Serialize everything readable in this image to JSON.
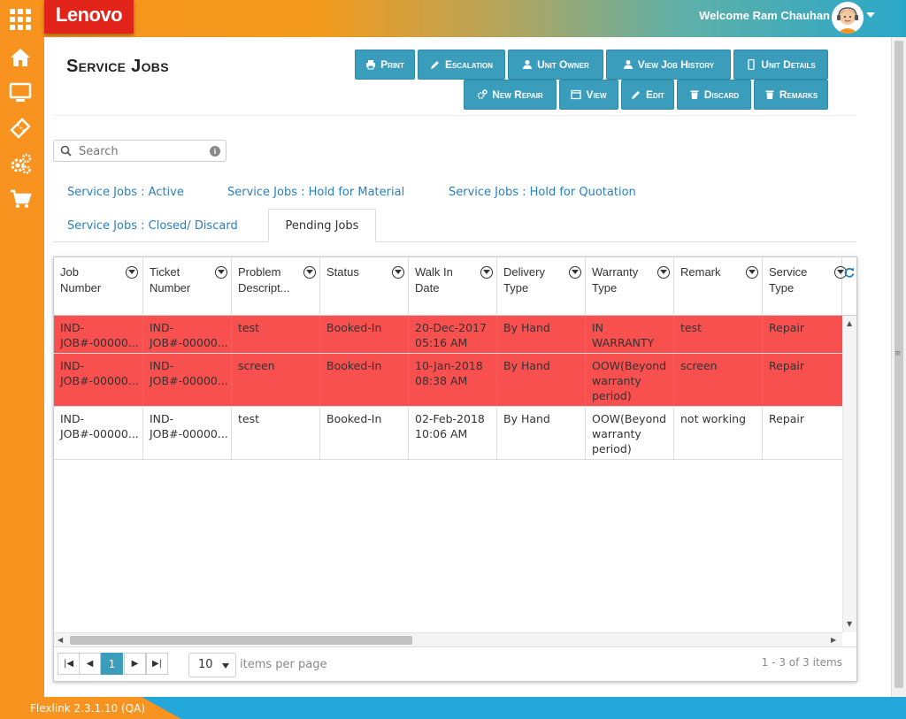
{
  "header": {
    "logo": "Lenovo",
    "welcome": "Welcome Ram Chauhan"
  },
  "sidebar": {
    "items": [
      "home-icon",
      "monitor-icon",
      "ticket-icon",
      "gears-icon",
      "cart-icon"
    ]
  },
  "page": {
    "title": "Service Jobs"
  },
  "toolbar": {
    "print": "Print",
    "escalation": "Escalation",
    "unit_owner": "Unit Owner",
    "view_job_history": "View Job History",
    "unit_details": "Unit Details",
    "new_repair": "New Repair",
    "view": "View",
    "edit": "Edit",
    "discard": "Discard",
    "remarks": "Remarks"
  },
  "search": {
    "placeholder": "Search"
  },
  "tabs": [
    "Service Jobs : Active",
    "Service Jobs : Hold for Material",
    "Service Jobs : Hold for Quotation",
    "Service Jobs : Closed/ Discard",
    "Pending Jobs"
  ],
  "grid": {
    "columns": [
      "Job Number",
      "Ticket Number",
      "Problem Descript...",
      "Status",
      "Walk In Date",
      "Delivery Type",
      "Warranty Type",
      "Remark",
      "Service Type"
    ],
    "rows": [
      {
        "highlight": "#f84f4f",
        "job": "IND-JOB#-00000...",
        "ticket": "IND-JOB#-00000...",
        "problem": "test",
        "status": "Booked-In",
        "walkin": "20-Dec-2017 05:16 AM",
        "delivery": "By Hand",
        "warranty": "IN WARRANTY",
        "remark": "test",
        "service": "Repair"
      },
      {
        "highlight": "#f84f4f",
        "job": "IND-JOB#-00000...",
        "ticket": "IND-JOB#-00000...",
        "problem": "screen",
        "status": "Booked-In",
        "walkin": "10-Jan-2018 08:38 AM",
        "delivery": "By Hand",
        "warranty": "OOW(Beyond warranty period)",
        "remark": "screen",
        "service": "Repair"
      },
      {
        "highlight": "#ffffff",
        "job": "IND-JOB#-00000...",
        "ticket": "IND-JOB#-00000...",
        "problem": "test",
        "status": "Booked-In",
        "walkin": "02-Feb-2018 10:06 AM",
        "delivery": "By Hand",
        "warranty": "OOW(Beyond warranty period)",
        "remark": "not working",
        "service": "Repair"
      }
    ]
  },
  "pager": {
    "current_page": "1",
    "page_size": "10",
    "items_per_page": "items per page",
    "summary": "1 - 3 of 3 items"
  },
  "footer": {
    "version": "Flexlink 2.3.1.10 (QA)"
  },
  "colors": {
    "accent": "#3a9dbb",
    "orange": "#f7931e",
    "highlight_row": "#f84f4f",
    "link": "#2a7fbf"
  }
}
